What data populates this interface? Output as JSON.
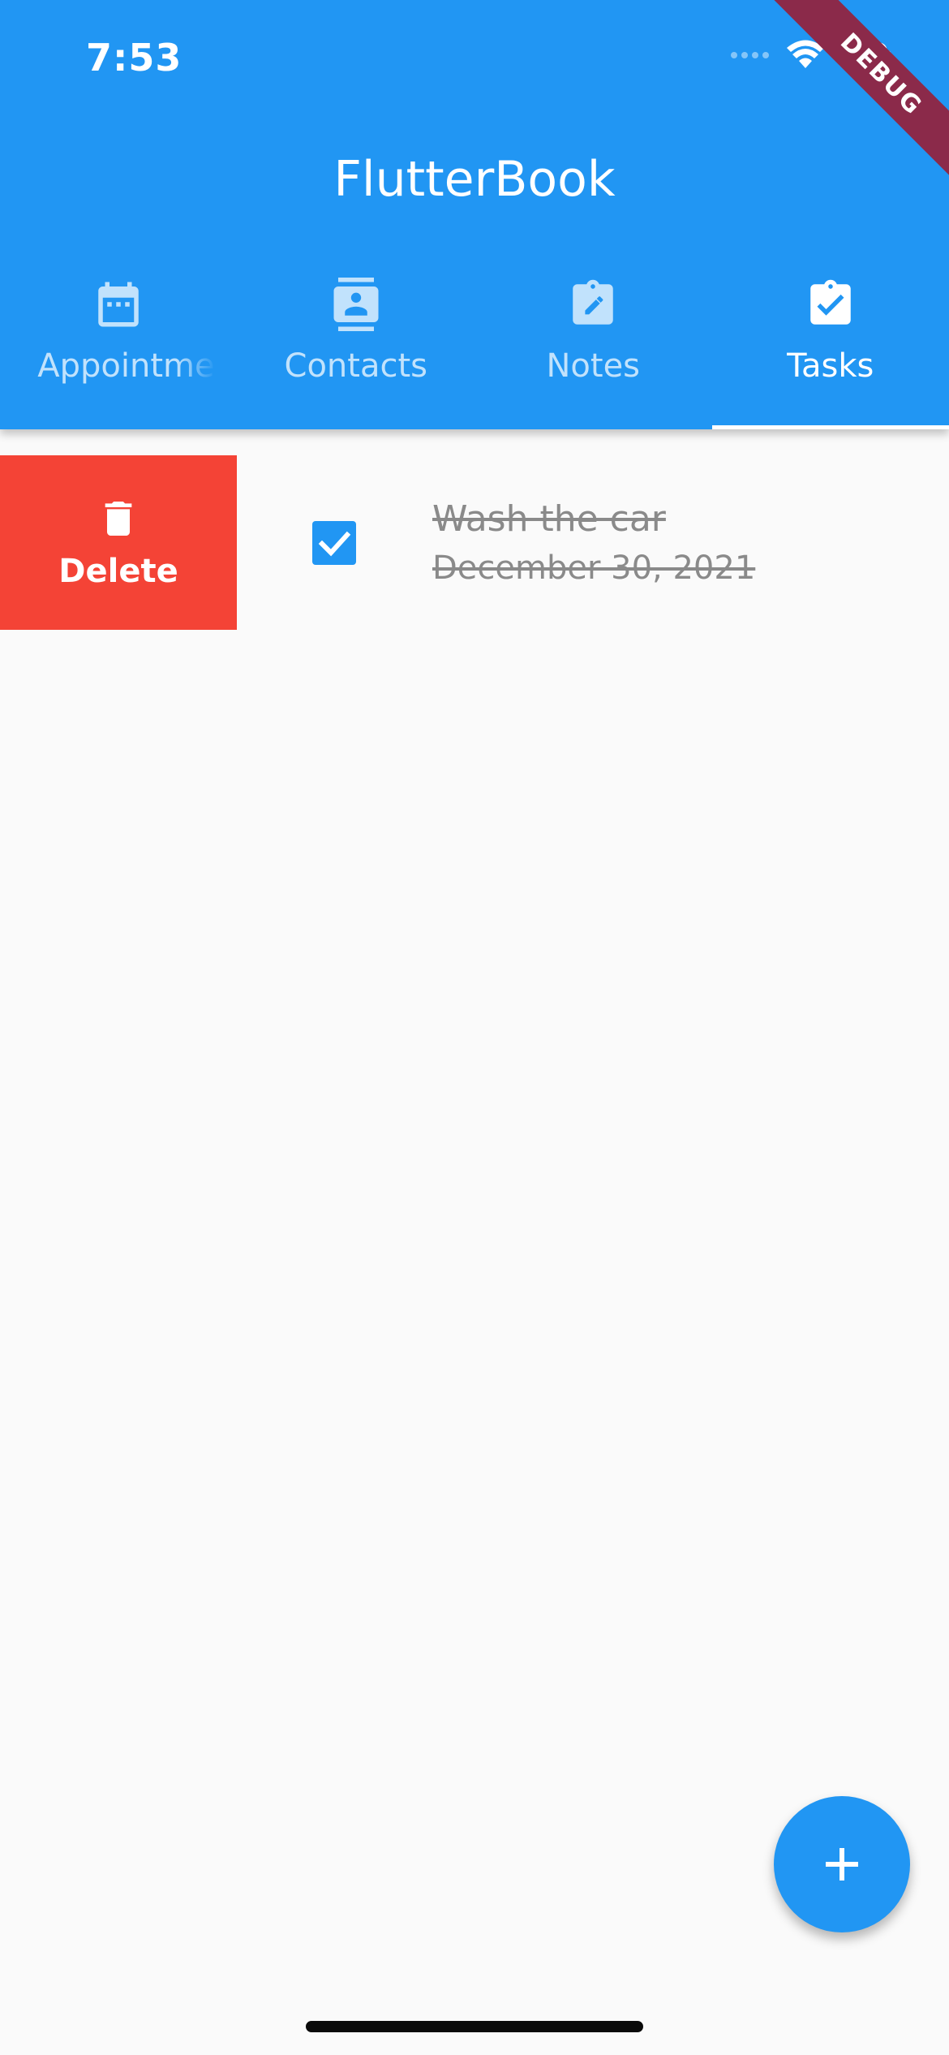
{
  "status_bar": {
    "time": "7:53"
  },
  "debug_banner": {
    "label": "DEBUG"
  },
  "app_bar": {
    "title": "FlutterBook"
  },
  "tabs": [
    {
      "label": "Appointments",
      "icon": "calendar-icon",
      "active": false
    },
    {
      "label": "Contacts",
      "icon": "contact-card-icon",
      "active": false
    },
    {
      "label": "Notes",
      "icon": "note-edit-icon",
      "active": false
    },
    {
      "label": "Tasks",
      "icon": "assignment-check-icon",
      "active": true
    }
  ],
  "task_list": {
    "items": [
      {
        "title": "Wash the car",
        "date": "December 30, 2021",
        "completed": true,
        "swipe_action": {
          "label": "Delete",
          "icon": "trash-icon"
        }
      }
    ]
  },
  "fab": {
    "icon": "add-icon"
  },
  "colors": {
    "primary": "#2196f3",
    "delete": "#f44336",
    "debug_banner": "#8b2a4a",
    "background": "#fafafa",
    "completed_text": "#8a8a8a"
  }
}
